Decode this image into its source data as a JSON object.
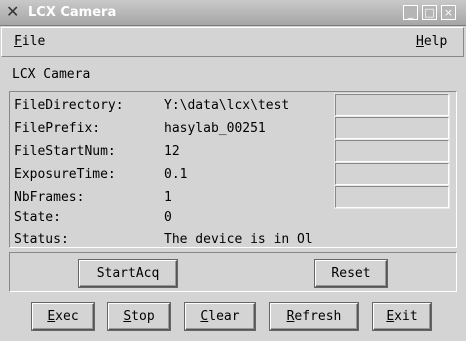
{
  "window": {
    "title": "LCX Camera",
    "icon": "x-logo-icon",
    "controls": {
      "minimize": "_",
      "maximize": "□",
      "close": "×"
    }
  },
  "menu": {
    "file": "File",
    "help": "Help"
  },
  "section_label": "LCX Camera",
  "fields": [
    {
      "label": "FileDirectory:",
      "value": "Y:\\data\\lcx\\test",
      "has_entry": true,
      "entry_value": ""
    },
    {
      "label": "FilePrefix:",
      "value": "hasylab_00251",
      "has_entry": true,
      "entry_value": ""
    },
    {
      "label": "FileStartNum:",
      "value": "12",
      "has_entry": true,
      "entry_value": ""
    },
    {
      "label": "ExposureTime:",
      "value": "0.1",
      "has_entry": true,
      "entry_value": ""
    },
    {
      "label": "NbFrames:",
      "value": "1",
      "has_entry": true,
      "entry_value": ""
    },
    {
      "label": "State:",
      "value": "0",
      "has_entry": false
    },
    {
      "label": "Status:",
      "value": "The device is in Ol",
      "has_entry": false
    }
  ],
  "actions": {
    "start_acq": "StartAcq",
    "reset": "Reset"
  },
  "buttons": {
    "exec": "Exec",
    "stop": "Stop",
    "clear": "Clear",
    "refresh": "Refresh",
    "exit": "Exit"
  }
}
